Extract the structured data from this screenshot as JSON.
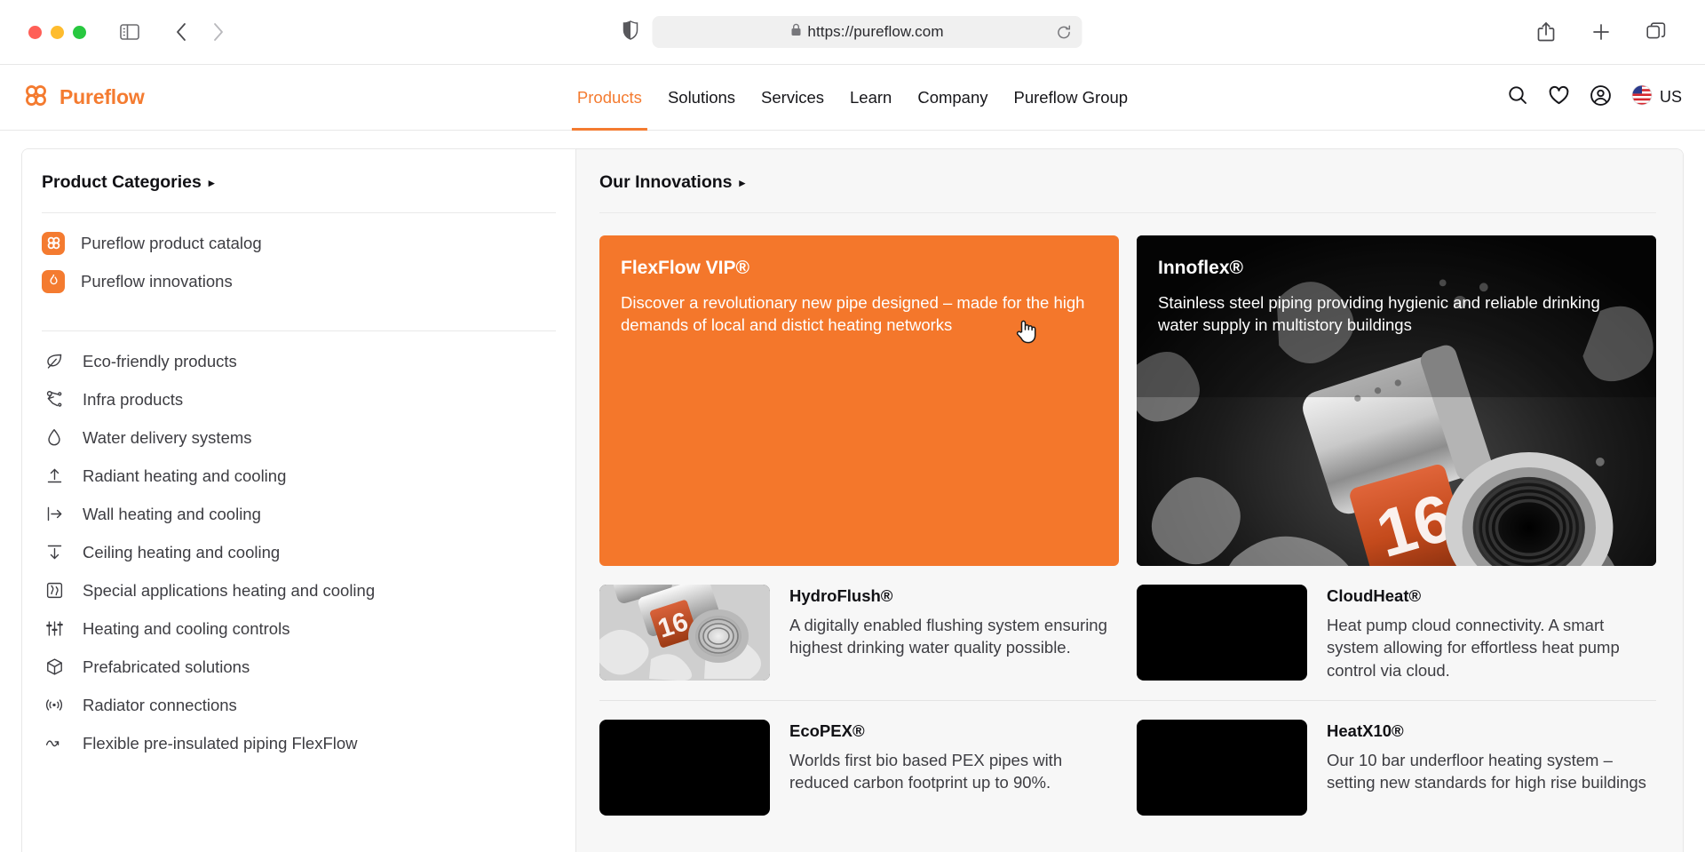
{
  "browser": {
    "url": "https://pureflow.com",
    "lock_icon": "lock-icon",
    "shield_icon": "shield-icon",
    "reload_icon": "reload-icon",
    "back_icon": "back-chevron-icon",
    "forward_icon": "forward-chevron-icon",
    "sidebar_icon": "sidebar-toggle-icon",
    "share_icon": "share-icon",
    "new_tab_icon": "plus-icon",
    "tabs_icon": "tab-overview-icon"
  },
  "header": {
    "brand": "Pureflow",
    "brand_color": "#F47B30",
    "logo_icon": "pureflow-clover-logo",
    "nav": [
      {
        "label": "Products",
        "active": true
      },
      {
        "label": "Solutions",
        "active": false
      },
      {
        "label": "Services",
        "active": false
      },
      {
        "label": "Learn",
        "active": false
      },
      {
        "label": "Company",
        "active": false
      },
      {
        "label": "Pureflow Group",
        "active": false
      }
    ],
    "actions": {
      "search_icon": "search-icon",
      "wishlist_icon": "heart-icon",
      "account_icon": "account-circle-icon",
      "flag_icon": "us-flag-icon",
      "locale": "US"
    }
  },
  "sidebar": {
    "title": "Product Categories",
    "caret": "▸",
    "featured": [
      {
        "label": "Pureflow product catalog",
        "icon": "pureflow-clover-icon"
      },
      {
        "label": "Pureflow innovations",
        "icon": "flame-icon"
      }
    ],
    "items": [
      {
        "label": "Eco-friendly products",
        "icon": "leaf-icon"
      },
      {
        "label": "Infra products",
        "icon": "infra-network-icon"
      },
      {
        "label": "Water delivery systems",
        "icon": "water-drop-icon"
      },
      {
        "label": "Radiant heating and cooling",
        "icon": "arrow-up-from-line-icon"
      },
      {
        "label": "Wall heating and cooling",
        "icon": "arrow-right-from-line-icon"
      },
      {
        "label": "Ceiling heating and cooling",
        "icon": "arrow-down-from-line-icon"
      },
      {
        "label": "Special applications heating and cooling",
        "icon": "special-application-panel-icon"
      },
      {
        "label": "Heating and cooling controls",
        "icon": "sliders-icon"
      },
      {
        "label": "Prefabricated solutions",
        "icon": "box-3d-icon"
      },
      {
        "label": "Radiator connections",
        "icon": "signal-waves-icon"
      },
      {
        "label": "Flexible pre-insulated piping FlexFlow",
        "icon": "wavy-arrow-icon"
      }
    ]
  },
  "main": {
    "title": "Our Innovations",
    "caret": "▸",
    "hero": [
      {
        "title": "FlexFlow VIP®",
        "desc": "Discover a revolutionary new pipe designed – made for the high demands of local and distict heating networks",
        "style": "orange",
        "bg_color": "#F4772B"
      },
      {
        "title": "Innoflex®",
        "desc": "Stainless steel piping providing hygienic and reliable drinking water supply in multistory buildings",
        "style": "photo",
        "bg_color": "#0c0c0c"
      }
    ],
    "products": [
      {
        "title": "HydroFlush®",
        "desc": "A digitally enabled flushing system ensuring highest drinking water quality possible.",
        "thumb": "pipe-fitting-photo"
      },
      {
        "title": "CloudHeat®",
        "desc": "Heat pump cloud connectivity. A smart system allowing for effortless heat pump control via cloud.",
        "thumb": "black-placeholder"
      },
      {
        "title": "EcoPEX®",
        "desc": "Worlds first bio based PEX pipes with reduced carbon footprint up to 90%.",
        "thumb": "black-placeholder"
      },
      {
        "title": "HeatX10®",
        "desc": "Our 10 bar underfloor heating system – setting new standards for high rise buildings",
        "thumb": "black-placeholder"
      }
    ]
  },
  "cursor": {
    "type": "pointing-hand"
  }
}
